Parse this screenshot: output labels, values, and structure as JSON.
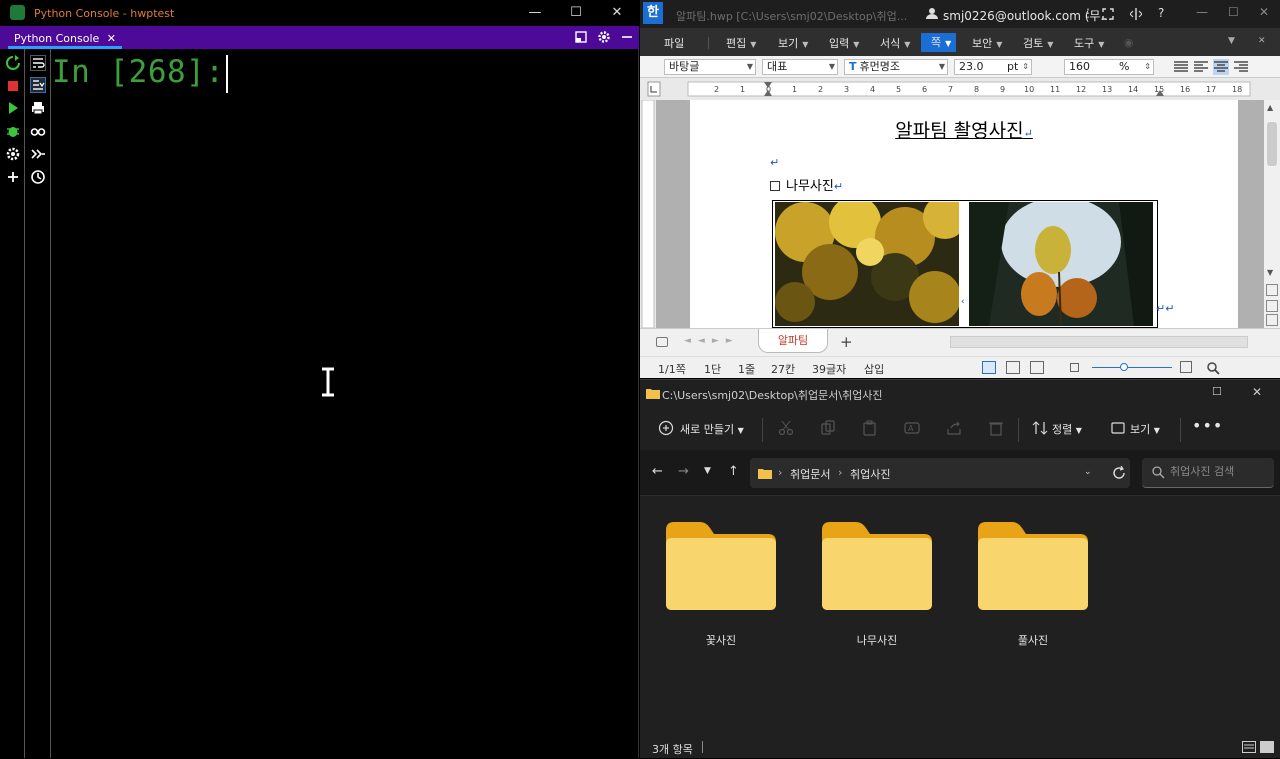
{
  "console": {
    "window_title": "Python Console - hwptest",
    "tab_label": "Python Console",
    "prompt": "In [268]:"
  },
  "hwp": {
    "window_title": "알파팀.hwp [C:\\Users\\smj02\\Desktop\\취업...",
    "account": "smj0226@outlook.com (무...",
    "menus": [
      "파일",
      "편집",
      "보기",
      "입력",
      "서식",
      "쪽",
      "보안",
      "검토",
      "도구"
    ],
    "active_menu": "쪽",
    "toolbar": {
      "style": "바탕글",
      "lang": "대표",
      "font": "휴먼명조",
      "size": "23.0",
      "size_unit": "pt",
      "zoom": "160",
      "zoom_unit": "%"
    },
    "doc": {
      "title": "알파팀 촬영사진",
      "heading": "나무사진"
    },
    "sheet_tab": "알파팀",
    "status": [
      "1/1쪽",
      "1단",
      "1줄",
      "27칸",
      "39글자",
      "삽입"
    ]
  },
  "explorer": {
    "path_title": "C:\\Users\\smj02\\Desktop\\취업문서\\취업사진",
    "new_button": "새로 만들기",
    "sort_button": "정렬",
    "view_button": "보기",
    "breadcrumbs": [
      "취업문서",
      "취업사진"
    ],
    "search_placeholder": "취업사진 검색",
    "folders": [
      "꽃사진",
      "나무사진",
      "풀사진"
    ],
    "status": "3개 항목"
  },
  "colors": {
    "console_tabbar": "#4d0a99",
    "console_prompt": "#3c9e3c",
    "hwp_active_menu": "#1b6fd4",
    "folder_yellow": "#f7c948"
  }
}
